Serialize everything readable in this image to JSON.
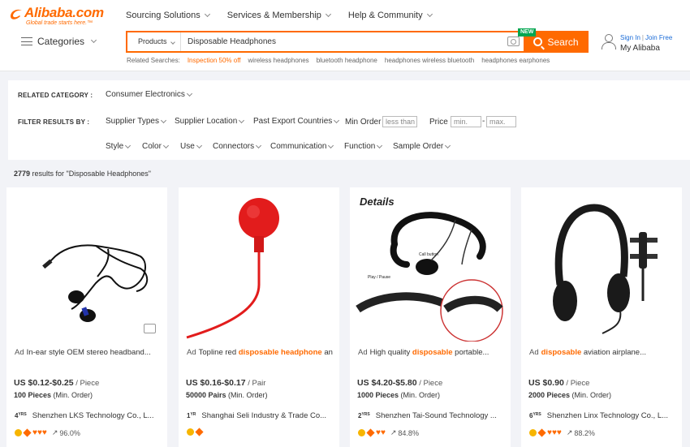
{
  "header": {
    "logo": "Alibaba.com",
    "tagline": "Global trade starts here.™",
    "nav": [
      "Sourcing Solutions",
      "Services & Membership",
      "Help & Community"
    ],
    "categories_label": "Categories",
    "search": {
      "type_label": "Products",
      "value": "Disposable Headphones",
      "button_label": "Search",
      "new_badge": "NEW"
    },
    "related": {
      "label": "Related Searches:",
      "items": [
        "Inspection 50% off",
        "wireless headphones",
        "bluetooth headphone",
        "headphones wireless bluetooth",
        "headphones earphones"
      ]
    },
    "account": {
      "sign_in": "Sign In",
      "join": "Join Free",
      "separator": "|",
      "my_alibaba": "My Alibaba"
    }
  },
  "filters": {
    "related_category_label": "RELATED CATEGORY :",
    "related_category_value": "Consumer Electronics",
    "filter_by_label": "FILTER RESULTS BY :",
    "row1": [
      "Supplier Types",
      "Supplier Location",
      "Past Export Countries"
    ],
    "min_order_label": "Min Order :",
    "min_order_placeholder": "less than",
    "price_label": "Price :",
    "price_min_placeholder": "min.",
    "price_sep": "-",
    "price_max_placeholder": "max.",
    "row2": [
      "Style",
      "Color",
      "Use",
      "Connectors",
      "Communication",
      "Function",
      "Sample Order"
    ]
  },
  "results": {
    "count": "2779",
    "text": " results for \"Disposable Headphones\""
  },
  "products": [
    {
      "ad": "Ad",
      "title_pre": "In-ear style OEM stereo headband...",
      "title_hl": "",
      "title_post": "",
      "price": "US $0.12-$0.25",
      "unit": " / Piece",
      "moq": "100 Pieces",
      "moq_note": " (Min. Order)",
      "years": "4",
      "supplier": "Shenzhen LKS Technology Co., L...",
      "rate": "96.0%",
      "hearts": "♥♥♥"
    },
    {
      "ad": "Ad",
      "title_pre": "Topline red ",
      "title_hl": "disposable headphone",
      "title_post": " an...",
      "price": "US $0.16-$0.17",
      "unit": " / Pair",
      "moq": "50000 Pairs",
      "moq_note": " (Min. Order)",
      "years": "1",
      "supplier": "Shanghai Seli Industry & Trade Co...",
      "rate": "",
      "hearts": ""
    },
    {
      "ad": "Ad",
      "title_pre": "High quality ",
      "title_hl": "disposable",
      "title_post": " portable...",
      "price": "US $4.20-$5.80",
      "unit": " / Piece",
      "moq": "1000 Pieces",
      "moq_note": " (Min. Order)",
      "years": "2",
      "supplier": "Shenzhen Tai-Sound Technology ...",
      "rate": "84.8%",
      "hearts": "♥♥"
    },
    {
      "ad": "Ad",
      "title_pre": "",
      "title_hl": "disposable",
      "title_post": " aviation airplane...",
      "price": "US $0.90",
      "unit": " / Piece",
      "moq": "2000 Pieces",
      "moq_note": " (Min. Order)",
      "years": "6",
      "supplier": "Shenzhen Linx Technology Co., L...",
      "rate": "88.2%",
      "hearts": "♥♥♥"
    }
  ],
  "image_text": {
    "details": "Details",
    "call_button": "Call button",
    "play_pause": "Play / Pause"
  },
  "yrs_suffix": "YRS",
  "yr_suffix": "YR"
}
